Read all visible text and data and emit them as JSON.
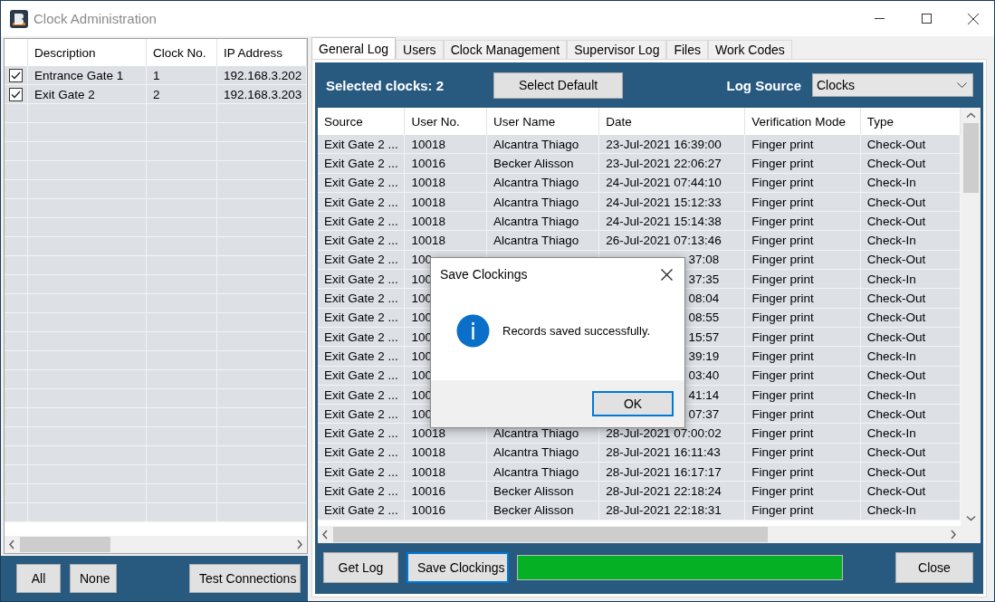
{
  "window": {
    "title": "Clock Administration"
  },
  "clocks": {
    "columns": [
      "Description",
      "Clock No.",
      "IP Address"
    ],
    "rows": [
      {
        "checked": true,
        "description": "Entrance Gate 1",
        "clock_no": "1",
        "ip_address": "192.168.3.202"
      },
      {
        "checked": true,
        "description": "Exit Gate 2",
        "clock_no": "2",
        "ip_address": "192.168.3.203"
      }
    ],
    "buttons": [
      "All",
      "None",
      "Test Connections"
    ]
  },
  "tabs": [
    {
      "label": "General Log",
      "selected": true
    },
    {
      "label": "Users",
      "selected": false
    },
    {
      "label": "Clock Management",
      "selected": false
    },
    {
      "label": "Supervisor Log",
      "selected": false
    },
    {
      "label": "Files",
      "selected": false
    },
    {
      "label": "Work Codes",
      "selected": false
    }
  ],
  "toolbar": {
    "selected_clocks": "Selected clocks: 2",
    "select_default": "Select Default",
    "log_source_label": "Log Source",
    "log_source": "Clocks"
  },
  "log": {
    "columns": [
      "Source",
      "User No.",
      "User Name",
      "Date",
      "Verification Mode",
      "Type"
    ],
    "rows": [
      {
        "source": "Exit Gate 2 ...",
        "user_no": "10018",
        "user_name": "Alcantra Thiago",
        "date": "23-Jul-2021 16:39:00",
        "verification_mode": "Finger print",
        "type": "Check-Out"
      },
      {
        "source": "Exit Gate 2 ...",
        "user_no": "10016",
        "user_name": "Becker Alisson",
        "date": "23-Jul-2021 22:06:27",
        "verification_mode": "Finger print",
        "type": "Check-Out"
      },
      {
        "source": "Exit Gate 2 ...",
        "user_no": "10018",
        "user_name": "Alcantra Thiago",
        "date": "24-Jul-2021 07:44:10",
        "verification_mode": "Finger print",
        "type": "Check-In"
      },
      {
        "source": "Exit Gate 2 ...",
        "user_no": "10018",
        "user_name": "Alcantra Thiago",
        "date": "24-Jul-2021 15:12:33",
        "verification_mode": "Finger print",
        "type": "Check-Out"
      },
      {
        "source": "Exit Gate 2 ...",
        "user_no": "10018",
        "user_name": "Alcantra Thiago",
        "date": "24-Jul-2021 15:14:38",
        "verification_mode": "Finger print",
        "type": "Check-Out"
      },
      {
        "source": "Exit Gate 2 ...",
        "user_no": "10018",
        "user_name": "Alcantra Thiago",
        "date": "26-Jul-2021 07:13:46",
        "verification_mode": "Finger print",
        "type": "Check-In"
      },
      {
        "source": "Exit Gate 2 ...",
        "user_no": "100",
        "date": "37:08",
        "verification_mode": "Finger print",
        "type": "Check-Out"
      },
      {
        "source": "Exit Gate 2 ...",
        "user_no": "100",
        "date": "37:35",
        "verification_mode": "Finger print",
        "type": "Check-In"
      },
      {
        "source": "Exit Gate 2 ...",
        "user_no": "100",
        "date": "08:04",
        "verification_mode": "Finger print",
        "type": "Check-Out"
      },
      {
        "source": "Exit Gate 2 ...",
        "user_no": "100",
        "date": "08:55",
        "verification_mode": "Finger print",
        "type": "Check-Out"
      },
      {
        "source": "Exit Gate 2 ...",
        "user_no": "100",
        "date": "15:57",
        "verification_mode": "Finger print",
        "type": "Check-Out"
      },
      {
        "source": "Exit Gate 2 ...",
        "user_no": "100",
        "date": "39:19",
        "verification_mode": "Finger print",
        "type": "Check-In"
      },
      {
        "source": "Exit Gate 2 ...",
        "user_no": "100",
        "date": "03:40",
        "verification_mode": "Finger print",
        "type": "Check-Out"
      },
      {
        "source": "Exit Gate 2 ...",
        "user_no": "100",
        "date": "41:14",
        "verification_mode": "Finger print",
        "type": "Check-In"
      },
      {
        "source": "Exit Gate 2 ...",
        "user_no": "100",
        "date": "07:37",
        "verification_mode": "Finger print",
        "type": "Check-Out"
      },
      {
        "source": "Exit Gate 2 ...",
        "user_no": "10018",
        "user_name": "Alcantra Thiago",
        "date": "28-Jul-2021 07:00:02",
        "verification_mode": "Finger print",
        "type": "Check-In"
      },
      {
        "source": "Exit Gate 2 ...",
        "user_no": "10018",
        "user_name": "Alcantra Thiago",
        "date": "28-Jul-2021 16:11:43",
        "verification_mode": "Finger print",
        "type": "Check-Out"
      },
      {
        "source": "Exit Gate 2 ...",
        "user_no": "10018",
        "user_name": "Alcantra Thiago",
        "date": "28-Jul-2021 16:17:17",
        "verification_mode": "Finger print",
        "type": "Check-Out"
      },
      {
        "source": "Exit Gate 2 ...",
        "user_no": "10016",
        "user_name": "Becker Alisson",
        "date": "28-Jul-2021 22:18:24",
        "verification_mode": "Finger print",
        "type": "Check-Out"
      },
      {
        "source": "Exit Gate 2 ...",
        "user_no": "10016",
        "user_name": "Becker Alisson",
        "date": "28-Jul-2021 22:18:31",
        "verification_mode": "Finger print",
        "type": "Check-In"
      }
    ]
  },
  "bottom": {
    "get_log": "Get Log",
    "save_clockings": "Save Clockings",
    "progress": {
      "level": 1
    },
    "close": "Close"
  },
  "dialog": {
    "title": "Save Clockings",
    "message": "Records saved successfully.",
    "ok": "OK"
  }
}
